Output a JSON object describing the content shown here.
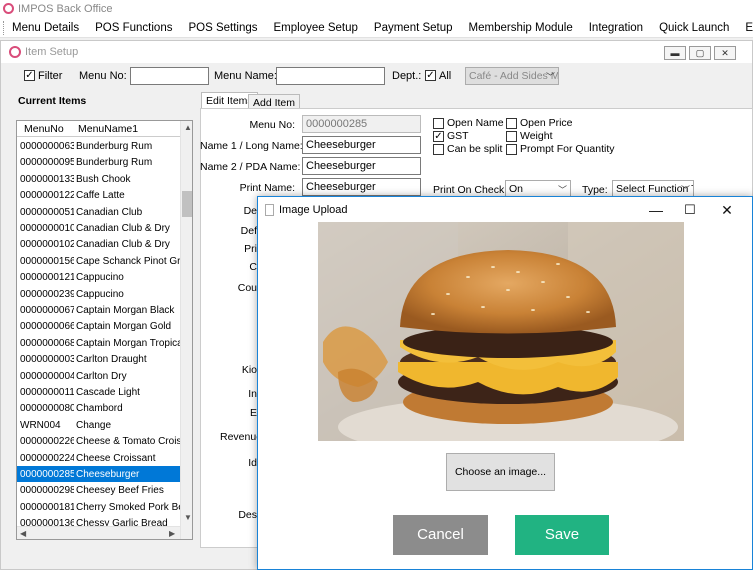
{
  "app": {
    "title": "IMPOS Back Office"
  },
  "menu": [
    "Menu Details",
    "POS Functions",
    "POS Settings",
    "Employee Setup",
    "Payment Setup",
    "Membership Module",
    "Integration",
    "Quick Launch",
    "Exit"
  ],
  "window": {
    "title": "Item Setup"
  },
  "filter": {
    "filter_label": "Filter",
    "menu_no_label": "Menu No:",
    "menu_name_label": "Menu Name:",
    "dept_label": "Dept.:",
    "all_label": "All",
    "dept_value": "Café - Add Sides M"
  },
  "current_items": {
    "heading": "Current Items",
    "columns": [
      "MenuNo",
      "MenuName1"
    ],
    "rows": [
      [
        "0000000063",
        "Bunderburg Rum"
      ],
      [
        "0000000095",
        "Bunderburg Rum"
      ],
      [
        "0000000133",
        "Bush Chook"
      ],
      [
        "0000000122",
        "Caffe Latte"
      ],
      [
        "0000000051",
        "Canadian Club"
      ],
      [
        "0000000010",
        "Canadian Club & Dry"
      ],
      [
        "0000000102",
        "Canadian Club & Dry"
      ],
      [
        "0000000156",
        "Cape Schanck Pinot Grigio"
      ],
      [
        "0000000121",
        "Cappucino"
      ],
      [
        "0000000239",
        "Cappucino"
      ],
      [
        "0000000067",
        "Captain Morgan Black"
      ],
      [
        "0000000066",
        "Captain Morgan Gold"
      ],
      [
        "0000000068",
        "Captain Morgan Tropical"
      ],
      [
        "0000000003",
        "Carlton Draught"
      ],
      [
        "0000000004",
        "Carlton Dry"
      ],
      [
        "0000000011",
        "Cascade Light"
      ],
      [
        "0000000080",
        "Chambord"
      ],
      [
        "WRN004",
        "Change"
      ],
      [
        "0000000226",
        "Cheese & Tomato Croissant"
      ],
      [
        "0000000224",
        "Cheese Croissant"
      ],
      [
        "0000000285",
        "Cheeseburger"
      ],
      [
        "0000000298",
        "Cheesey Beef Fries"
      ],
      [
        "0000000181",
        "Cherry Smoked Pork Belly"
      ],
      [
        "0000000136",
        "Chessy Garlic Bread"
      ]
    ],
    "selected_index": 20
  },
  "tabs": [
    "Edit Items",
    "Add Item"
  ],
  "form": {
    "menu_no_label": "Menu No:",
    "menu_no_value": "0000000285",
    "name1_label": "Name 1 / Long Name:",
    "name1_value": "Cheeseburger",
    "name2_label": "Name 2 / PDA Name:",
    "name2_value": "Cheeseburger",
    "print_name_label": "Print Name:",
    "print_name_value": "Cheeseburger",
    "open_name": "Open Name",
    "gst": "GST",
    "can_be_split": "Can be split",
    "open_price": "Open Price",
    "weight": "Weight",
    "prompt_qty": "Prompt For Quantity",
    "print_on_check_label": "Print On Check:",
    "print_on_check_value": "On",
    "type_label": "Type:",
    "type_value": "Select Function T",
    "partial_labels": [
      "De",
      "Def",
      "Pri",
      "C",
      "Cou",
      "Kio",
      "In",
      "E",
      "Revenue",
      "Id",
      "Des"
    ]
  },
  "modal": {
    "title": "Image Upload",
    "choose_label": "Choose an image...",
    "cancel_label": "Cancel",
    "save_label": "Save",
    "cancel_color": "#8c8c8c",
    "save_color": "#21b382"
  }
}
